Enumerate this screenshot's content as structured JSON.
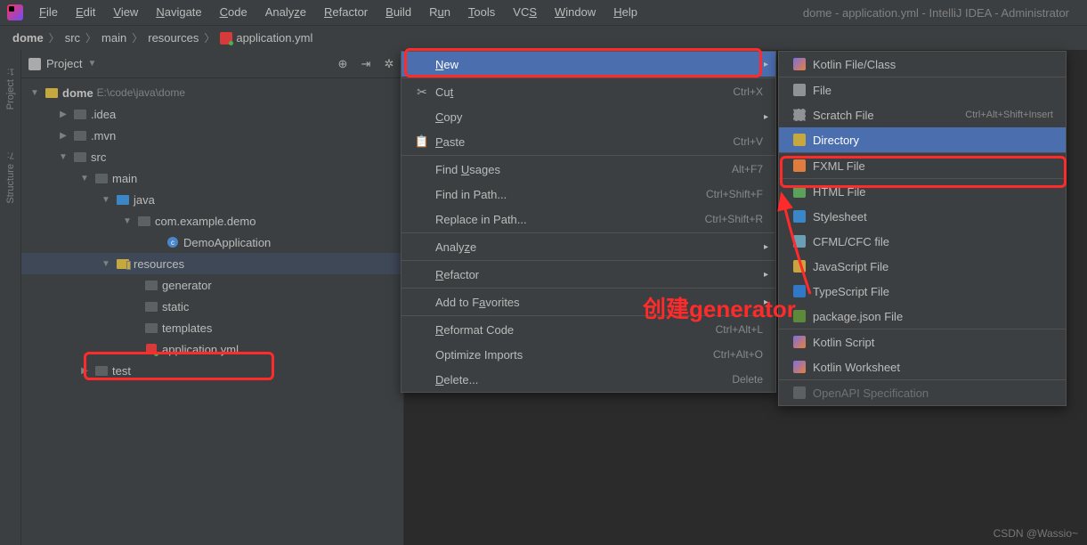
{
  "menubar": {
    "items": [
      "File",
      "Edit",
      "View",
      "Navigate",
      "Code",
      "Analyze",
      "Refactor",
      "Build",
      "Run",
      "Tools",
      "VCS",
      "Window",
      "Help"
    ],
    "title": "dome - application.yml - IntelliJ IDEA - Administrator"
  },
  "breadcrumb": {
    "root": "dome",
    "parts": [
      "src",
      "main",
      "resources"
    ],
    "file": "application.yml"
  },
  "gutter": {
    "project": "Project",
    "proj_num": "1:",
    "structure": "Structure",
    "struct_num": "7:"
  },
  "project_panel": {
    "title": "Project"
  },
  "tree": {
    "root": {
      "name": "dome",
      "path": "E:\\code\\java\\dome"
    },
    "idea": ".idea",
    "mvn": ".mvn",
    "src": "src",
    "main": "main",
    "java": "java",
    "pkg": "com.example.demo",
    "democls": "DemoApplication",
    "resources": "resources",
    "generator": "generator",
    "static": "static",
    "templates": "templates",
    "appyml": "application.yml",
    "test": "test"
  },
  "context_menu": {
    "new": "New",
    "cut": "Cut",
    "cut_sc": "Ctrl+X",
    "copy": "Copy",
    "paste": "Paste",
    "paste_sc": "Ctrl+V",
    "find_usages": "Find Usages",
    "find_usages_sc": "Alt+F7",
    "find_in_path": "Find in Path...",
    "find_in_path_sc": "Ctrl+Shift+F",
    "replace_in_path": "Replace in Path...",
    "replace_in_path_sc": "Ctrl+Shift+R",
    "analyze": "Analyze",
    "refactor": "Refactor",
    "add_fav": "Add to Favorites",
    "reformat": "Reformat Code",
    "reformat_sc": "Ctrl+Alt+L",
    "optimize": "Optimize Imports",
    "optimize_sc": "Ctrl+Alt+O",
    "delete": "Delete...",
    "delete_sc": "Delete"
  },
  "submenu": {
    "kotlin": "Kotlin File/Class",
    "file": "File",
    "scratch": "Scratch File",
    "scratch_sc": "Ctrl+Alt+Shift+Insert",
    "directory": "Directory",
    "fxml": "FXML File",
    "html": "HTML File",
    "stylesheet": "Stylesheet",
    "cfml": "CFML/CFC file",
    "js": "JavaScript File",
    "ts": "TypeScript File",
    "pkg": "package.json File",
    "kscript": "Kotlin Script",
    "kws": "Kotlin Worksheet",
    "openapi": "OpenAPI Specification"
  },
  "annotation": "创建generator",
  "watermark": "CSDN @Wassio~"
}
